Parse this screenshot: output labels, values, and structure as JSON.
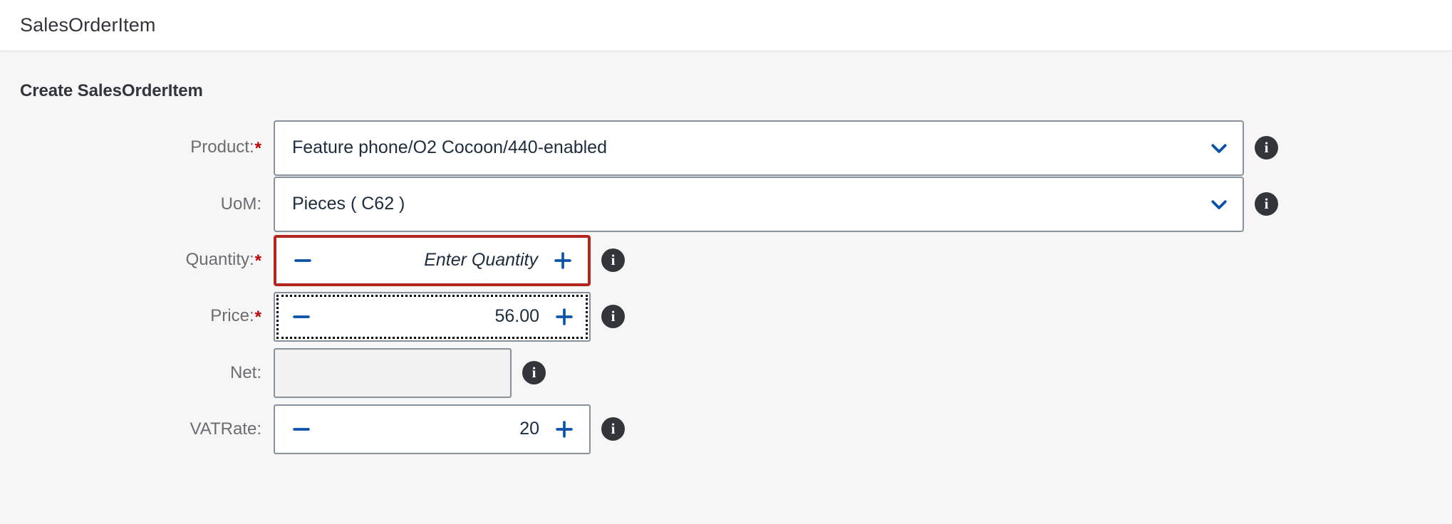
{
  "header": {
    "title": "SalesOrderItem"
  },
  "section": {
    "title": "Create SalesOrderItem"
  },
  "colors": {
    "page_background": "#f6f6f6",
    "header_background": "#ffffff",
    "label_text": "#6a6d70",
    "value_text": "#1d2d3e",
    "required_asterisk": "#bb0000",
    "error_border": "#b3261e",
    "field_border": "#89919a",
    "accent_blue": "#0a53a8",
    "info_icon_background": "#32363a",
    "readonly_background": "#f2f2f2"
  },
  "icons": {
    "chevron_down": "chevron-down-icon",
    "minus": "minus-icon",
    "plus": "plus-icon",
    "info": "info-icon"
  },
  "form": {
    "fields": [
      {
        "id": "product",
        "label": "Product:",
        "required": true,
        "type": "select",
        "value": "Feature phone/O2 Cocoon/440-enabled",
        "placeholder": "",
        "state": "normal",
        "info": "i"
      },
      {
        "id": "uom",
        "label": "UoM:",
        "required": false,
        "type": "select",
        "value": "Pieces ( C62 )",
        "placeholder": "",
        "state": "normal",
        "info": "i"
      },
      {
        "id": "quantity",
        "label": "Quantity:",
        "required": true,
        "type": "stepper",
        "value": "",
        "placeholder": "Enter Quantity",
        "state": "error",
        "info": "i"
      },
      {
        "id": "price",
        "label": "Price:",
        "required": true,
        "type": "stepper",
        "value": "56.00",
        "placeholder": "",
        "state": "focused",
        "info": "i"
      },
      {
        "id": "net",
        "label": "Net:",
        "required": false,
        "type": "readonly",
        "value": "",
        "placeholder": "",
        "state": "readonly",
        "info": "i"
      },
      {
        "id": "vatrate",
        "label": "VATRate:",
        "required": true,
        "label_required_hidden": true,
        "type": "stepper",
        "value": "20",
        "placeholder": "",
        "state": "normal",
        "info": "i"
      }
    ]
  }
}
